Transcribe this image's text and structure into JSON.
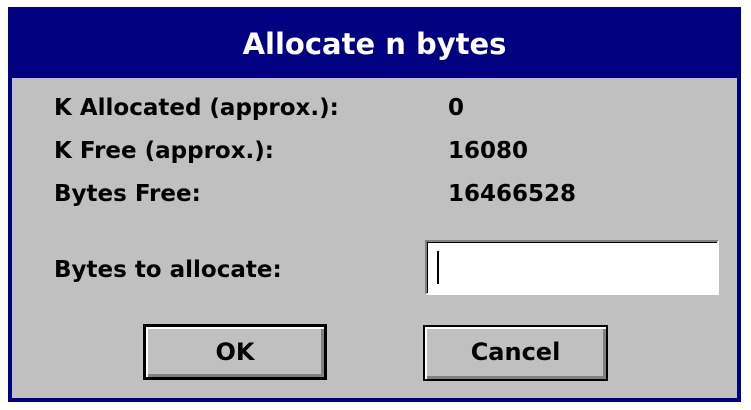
{
  "window": {
    "title": "Allocate n bytes"
  },
  "info": [
    {
      "label": "K Allocated (approx.):",
      "value": "0"
    },
    {
      "label": "K Free (approx.):",
      "value": "16080"
    },
    {
      "label": "Bytes Free:",
      "value": "16466528"
    }
  ],
  "input": {
    "label": "Bytes to allocate:",
    "value": ""
  },
  "buttons": {
    "ok": "OK",
    "cancel": "Cancel"
  },
  "colors": {
    "titlebar": "#000080",
    "dialog_bg": "#c0c0c0",
    "title_text": "#ffffff"
  }
}
